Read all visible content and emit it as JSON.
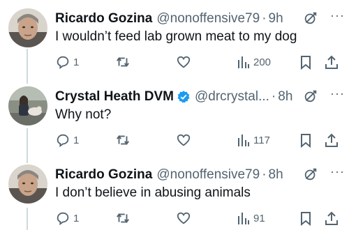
{
  "tweets": [
    {
      "name": "Ricardo Gozina",
      "handle": "@nonoffensive79",
      "separator": "·",
      "time": "9h",
      "text": "I wouldn’t feed lab grown meat to my dog",
      "replies": "1",
      "views": "200",
      "verified": false
    },
    {
      "name": "Crystal Heath DVM",
      "handle": "@drcrystal...",
      "separator": "·",
      "time": "8h",
      "text": "Why not?",
      "replies": "1",
      "views": "117",
      "verified": true
    },
    {
      "name": "Ricardo Gozina",
      "handle": "@nonoffensive79",
      "separator": "·",
      "time": "8h",
      "text": "I don’t believe in abusing animals",
      "replies": "1",
      "views": "91",
      "verified": false
    }
  ],
  "more_glyph": "···",
  "colors": {
    "text": "#0f1419",
    "muted": "#536471",
    "verified": "#1d9bf0",
    "thread_line": "#cfd9de"
  },
  "icons": [
    "reply-icon",
    "retweet-icon",
    "like-icon",
    "views-icon",
    "bookmark-icon",
    "share-icon",
    "grok-icon",
    "more-icon",
    "verified-badge-icon"
  ]
}
